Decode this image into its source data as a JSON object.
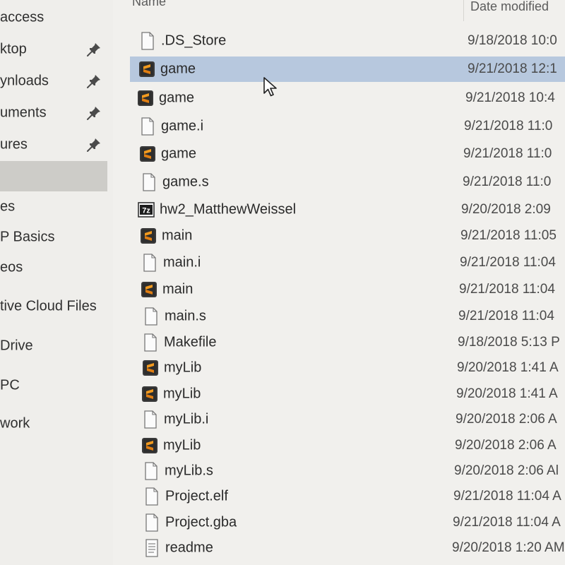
{
  "sidebar": {
    "items": [
      {
        "label": "access",
        "pinned": false
      },
      {
        "label": "ktop",
        "pinned": true
      },
      {
        "label": "ynloads",
        "pinned": true
      },
      {
        "label": "uments",
        "pinned": true
      },
      {
        "label": "ures",
        "pinned": true
      },
      {
        "label": "",
        "pinned": false,
        "selected": true
      },
      {
        "label": "es",
        "pinned": false
      },
      {
        "label": "P Basics",
        "pinned": false
      },
      {
        "label": "eos",
        "pinned": false
      },
      {
        "label": "tive Cloud Files",
        "pinned": false
      },
      {
        "label": "Drive",
        "pinned": false
      },
      {
        "label": "PC",
        "pinned": false
      },
      {
        "label": "work",
        "pinned": false
      }
    ]
  },
  "columns": {
    "name": "Name",
    "date": "Date modified"
  },
  "files": [
    {
      "name": ".DS_Store",
      "date": "9/18/2018 10:0",
      "icon": "file-icon"
    },
    {
      "name": "game",
      "date": "9/21/2018 12:1",
      "icon": "sublime-icon",
      "selected": true
    },
    {
      "name": "game",
      "date": "9/21/2018 10:4",
      "icon": "sublime-icon"
    },
    {
      "name": "game.i",
      "date": "9/21/2018 11:0",
      "icon": "file-icon"
    },
    {
      "name": "game",
      "date": "9/21/2018 11:0",
      "icon": "sublime-icon"
    },
    {
      "name": "game.s",
      "date": "9/21/2018 11:0",
      "icon": "file-icon"
    },
    {
      "name": "hw2_MatthewWeissel",
      "date": "9/20/2018 2:09",
      "icon": "7zip-icon"
    },
    {
      "name": "main",
      "date": "9/21/2018 11:05",
      "icon": "sublime-icon"
    },
    {
      "name": "main.i",
      "date": "9/21/2018 11:04",
      "icon": "file-icon"
    },
    {
      "name": "main",
      "date": "9/21/2018 11:04",
      "icon": "sublime-icon"
    },
    {
      "name": "main.s",
      "date": "9/21/2018 11:04",
      "icon": "file-icon"
    },
    {
      "name": "Makefile",
      "date": "9/18/2018 5:13 P",
      "icon": "file-icon"
    },
    {
      "name": "myLib",
      "date": "9/20/2018 1:41 A",
      "icon": "sublime-icon"
    },
    {
      "name": "myLib",
      "date": "9/20/2018 1:41 A",
      "icon": "sublime-icon"
    },
    {
      "name": "myLib.i",
      "date": "9/20/2018 2:06 A",
      "icon": "file-icon"
    },
    {
      "name": "myLib",
      "date": "9/20/2018 2:06 A",
      "icon": "sublime-icon"
    },
    {
      "name": "myLib.s",
      "date": "9/20/2018 2:06 Al",
      "icon": "file-icon"
    },
    {
      "name": "Project.elf",
      "date": "9/21/2018 11:04 A",
      "icon": "file-icon"
    },
    {
      "name": "Project.gba",
      "date": "9/21/2018 11:04 A",
      "icon": "file-icon"
    },
    {
      "name": "readme",
      "date": "9/20/2018 1:20 AM",
      "icon": "text-file-icon"
    }
  ],
  "colors": {
    "selection": "#b7c8de",
    "sidebar_selected": "#cdccc8",
    "background": "#f1f0ed"
  }
}
